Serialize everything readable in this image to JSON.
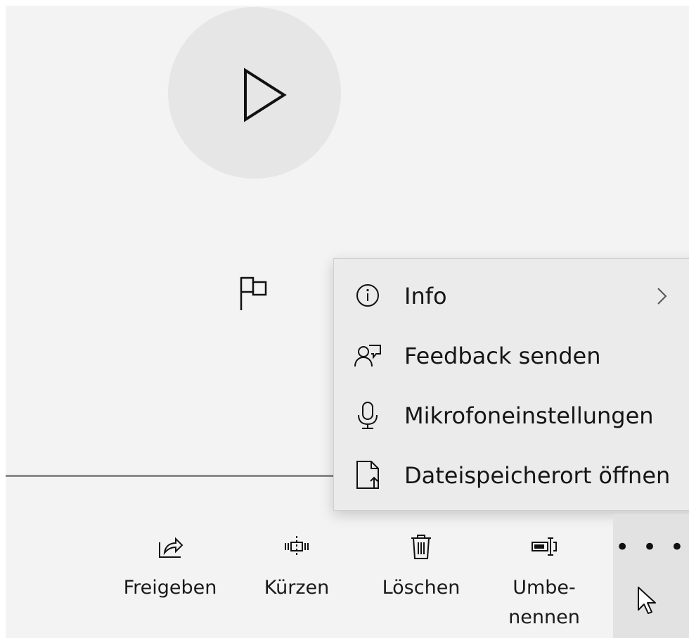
{
  "menu": {
    "items": [
      {
        "icon": "info-icon",
        "label": "Info",
        "has_submenu": true
      },
      {
        "icon": "feedback-icon",
        "label": "Feedback senden"
      },
      {
        "icon": "microphone-icon",
        "label": "Mikrofoneinstellungen"
      },
      {
        "icon": "file-location-icon",
        "label": "Dateispeicherort öffnen"
      }
    ]
  },
  "toolbar": {
    "share_label": "Freigeben",
    "trim_label": "Kürzen",
    "delete_label": "Löschen",
    "rename_label": "Umbe-\nnennen",
    "more_label": "• • •"
  },
  "icons": {
    "play": "play-icon",
    "marker": "flag-icon",
    "share": "share-icon",
    "trim": "trim-icon",
    "delete": "trash-icon",
    "rename": "rename-icon",
    "more": "more-icon",
    "cursor": "mouse-cursor-icon"
  },
  "colors": {
    "background": "#f3f3f3",
    "play_circle": "#e6e6e6",
    "menu_background": "#ebebeb",
    "more_button_background": "#e2e2e2",
    "timeline": "#8a8a8a"
  }
}
